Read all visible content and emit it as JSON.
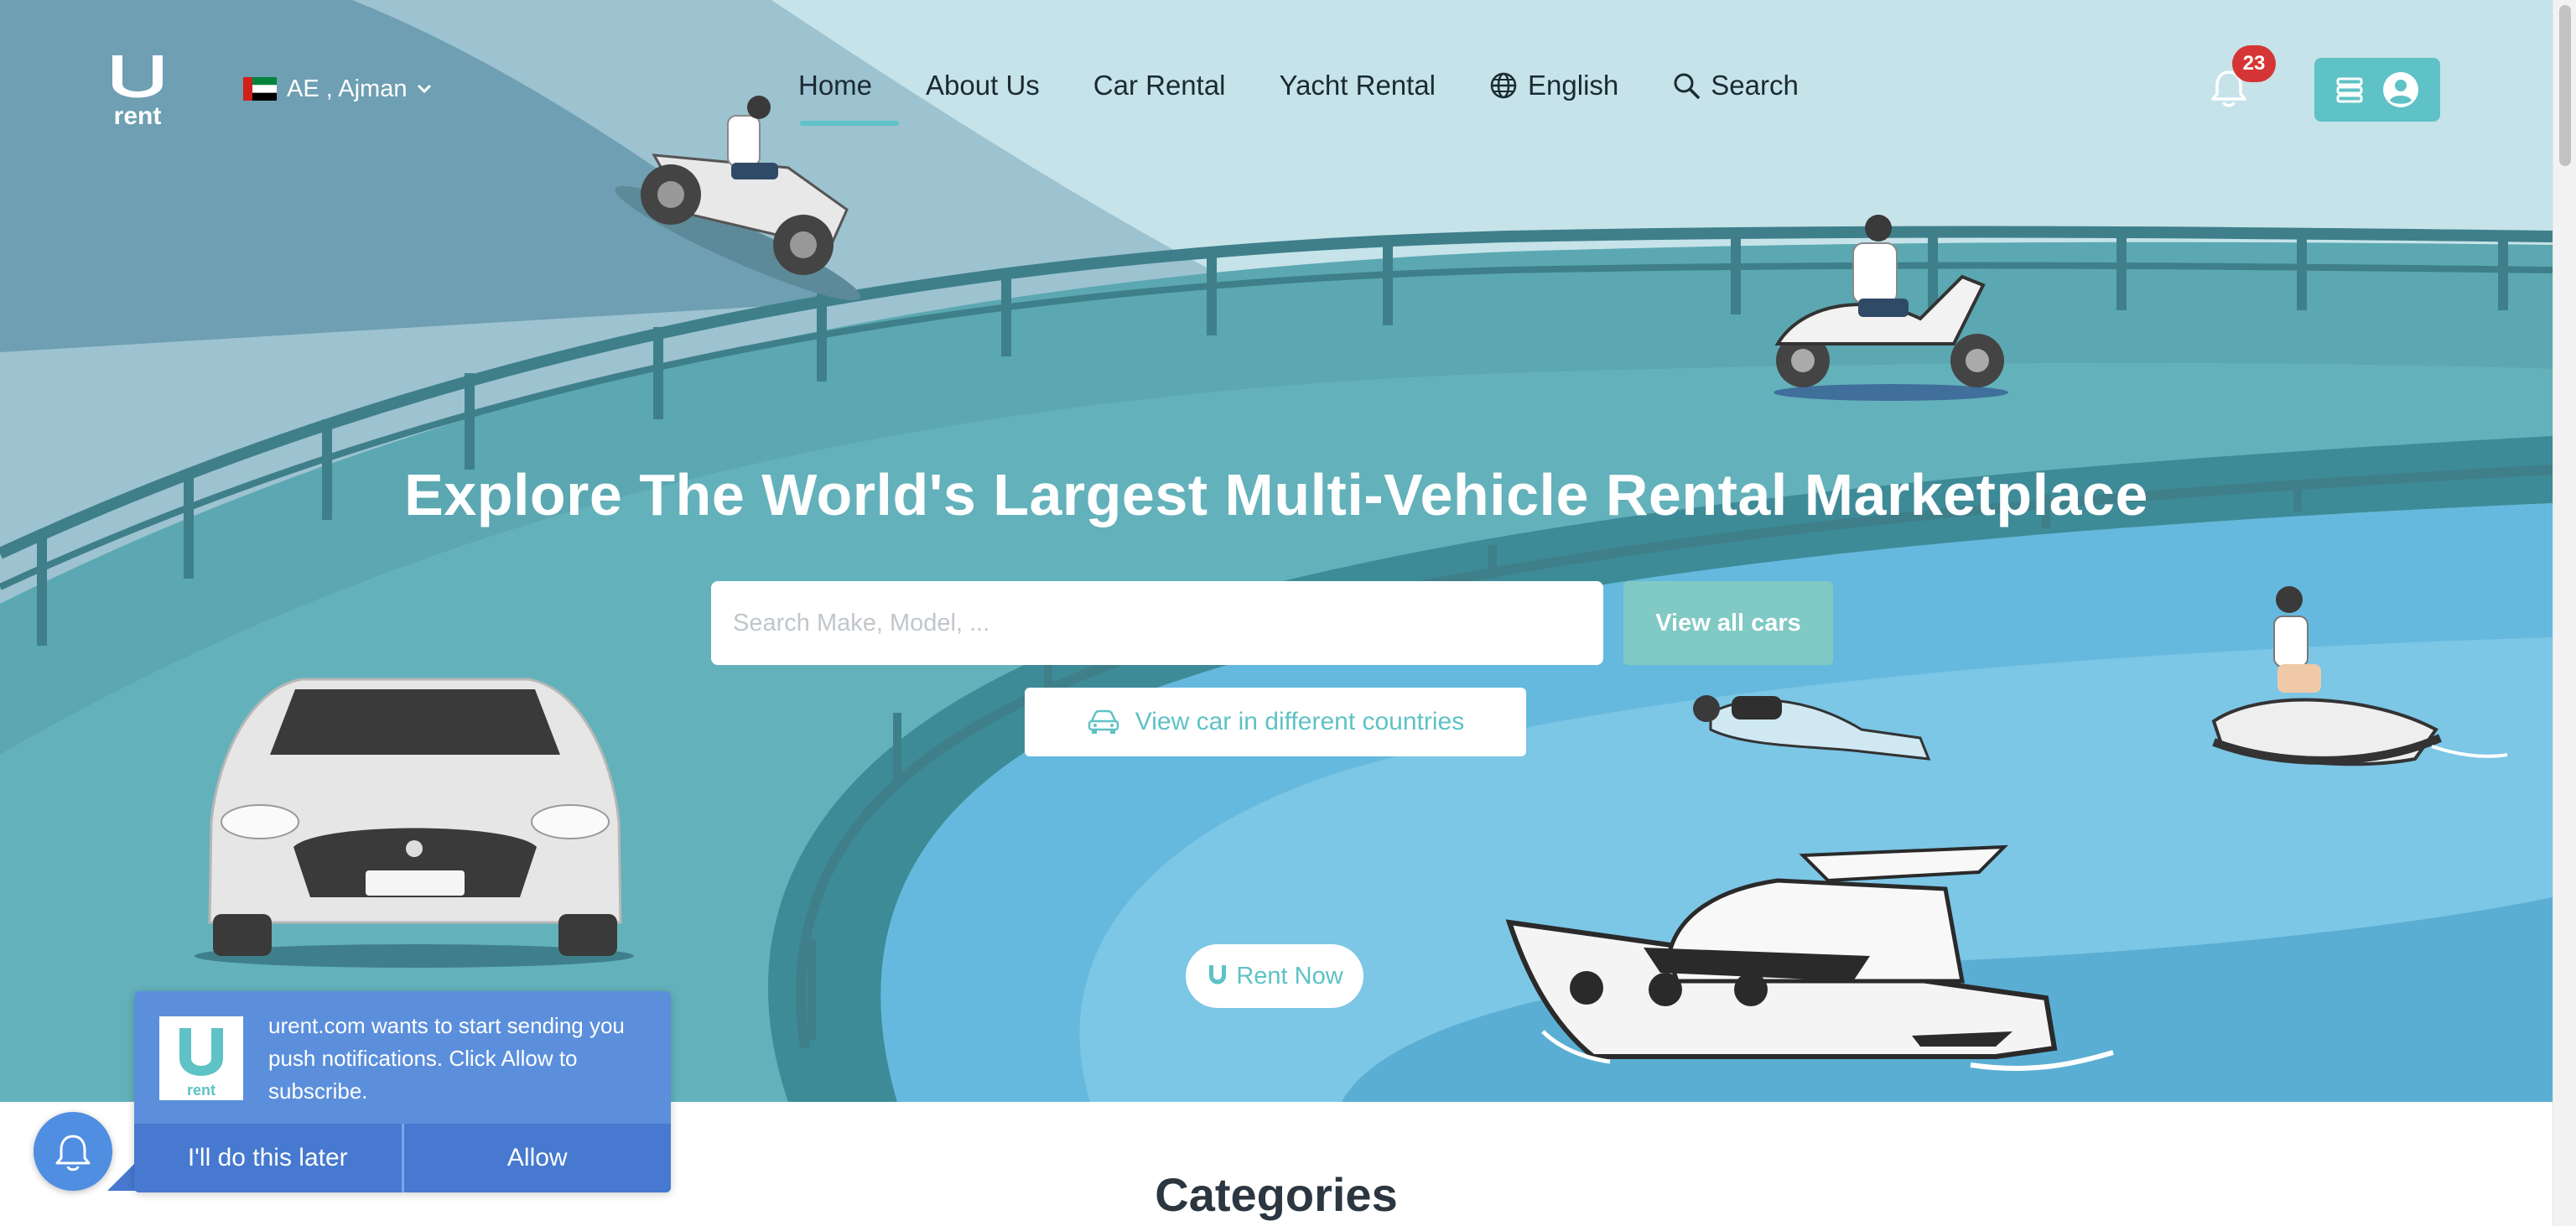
{
  "header": {
    "region": {
      "label": "AE , Ajman",
      "flag_icon": "uae-flag-icon"
    },
    "nav": [
      {
        "label": "Home",
        "active": true
      },
      {
        "label": "About Us"
      },
      {
        "label": "Car Rental"
      },
      {
        "label": "Yacht Rental"
      },
      {
        "label": "English",
        "icon": "globe-icon"
      },
      {
        "label": "Search",
        "icon": "search-icon"
      }
    ],
    "notifications": {
      "count": "23",
      "icon": "bell-icon"
    },
    "account": {
      "icons": [
        "menu-icon",
        "user-avatar-icon"
      ]
    }
  },
  "hero": {
    "title": "Explore The World's Largest Multi-Vehicle Rental Marketplace",
    "search": {
      "placeholder": "Search Make, Model, ..."
    },
    "view_all_button": "View all cars",
    "countries_button": "View car in different countries",
    "rent_now_button": "Rent Now"
  },
  "categories": {
    "title": "Categories"
  },
  "push_prompt": {
    "message": "urent.com wants to start sending you push notifications. Click Allow to subscribe.",
    "later_button": "I'll do this later",
    "allow_button": "Allow"
  },
  "colors": {
    "brand_teal": "#5ec2c6",
    "nav_text": "#1b2a33",
    "badge_red": "#d63535",
    "prompt_blue": "#5b8fdc",
    "water_blue": "#66b9de"
  }
}
